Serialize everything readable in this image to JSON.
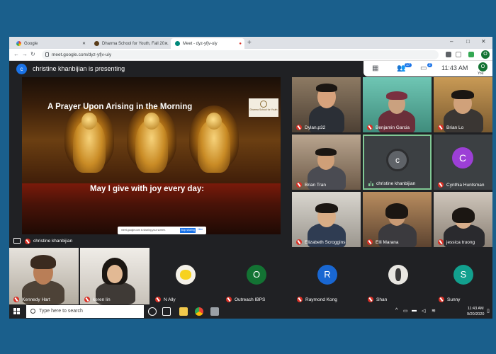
{
  "browser": {
    "tabs": [
      {
        "label": "Google",
        "icon": "google-icon"
      },
      {
        "label": "Dharma School for Youth, Fall 20…",
        "icon": "dharma-icon"
      },
      {
        "label": "Meet - dyz-yfjv-uiy",
        "icon": "meet-icon"
      }
    ],
    "new_tab": "+",
    "minimize": "–",
    "maximize": "□",
    "close": "✕",
    "url": "meet.google.com/dyz-yfjv-uiy",
    "profile_initial": "O"
  },
  "meet": {
    "presenter_initial": "c",
    "presenting_text": "christine khanbijian is presenting",
    "participant_count": "17",
    "chat_count": "2",
    "time": "11:43 AM",
    "you_initial": "O",
    "you_label": "You"
  },
  "slide": {
    "title": "A Prayer Upon Arising in the Morning",
    "caption": "May I give with joy every day:",
    "logo_text": "Dharma School for Youth",
    "share_text": "meet.google.com is sharing your screen.",
    "stop_sharing": "Stop sharing",
    "hide": "Hide"
  },
  "presenter_name": "christine khanbijian",
  "grid_tiles": [
    {
      "name": "Dylan.p32"
    },
    {
      "name": "Benjamin Garcia"
    },
    {
      "name": "Brian Lo"
    },
    {
      "name": "Brian Tran"
    },
    {
      "name": "christine khanbijian",
      "initial": "c"
    },
    {
      "name": "Cynthia Huntsman",
      "initial": "C"
    },
    {
      "name": "Elizabeth Scroggins"
    },
    {
      "name": "Elli Marana"
    },
    {
      "name": "jessica truong"
    }
  ],
  "bottom_tiles": [
    {
      "name": "Kennedy Hart"
    },
    {
      "name": "keren lin"
    },
    {
      "name": "N Ally"
    },
    {
      "name": "Outreach IBPS",
      "initial": "O"
    },
    {
      "name": "Raymond Kong",
      "initial": "R"
    },
    {
      "name": "Shan"
    },
    {
      "name": "Sunny",
      "initial": "S"
    }
  ],
  "taskbar": {
    "search_placeholder": "Type here to search",
    "time": "11:43 AM",
    "date": "9/20/2020"
  }
}
